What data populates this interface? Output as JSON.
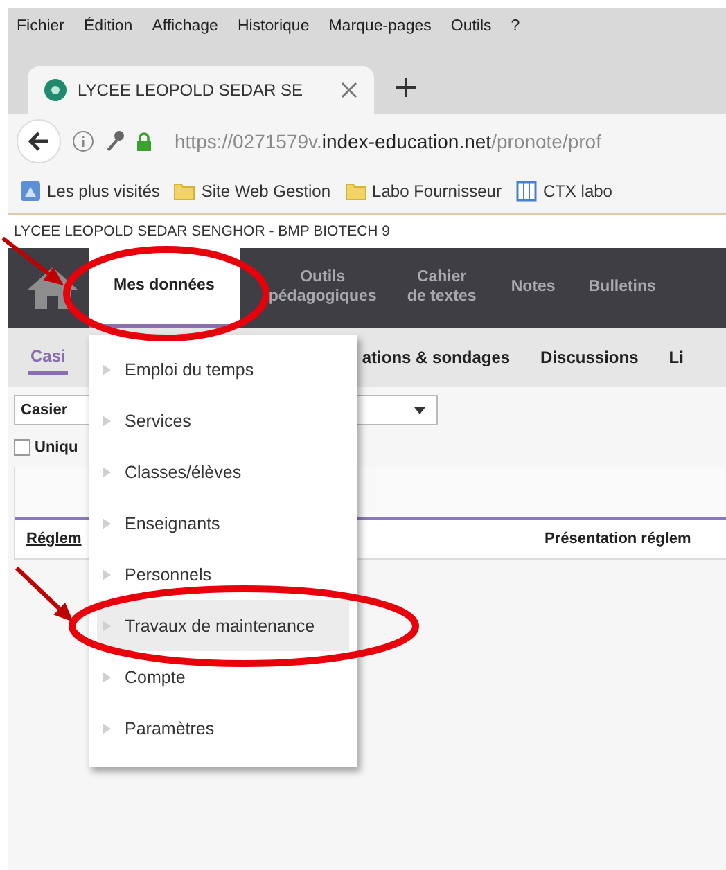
{
  "menu_bar": [
    "Fichier",
    "Édition",
    "Affichage",
    "Historique",
    "Marque-pages",
    "Outils",
    "?"
  ],
  "browser_tab": {
    "title": "LYCEE LEOPOLD SEDAR SE",
    "selected": true
  },
  "address_bar": {
    "url_parts": [
      {
        "text": "https://0271579v.",
        "emphasis": false
      },
      {
        "text": "index-education.net",
        "emphasis": true
      },
      {
        "text": "/pronote/prof",
        "emphasis": false
      }
    ]
  },
  "bookmarks": [
    {
      "label": "Les plus visités",
      "kind": "history"
    },
    {
      "label": "Site Web Gestion",
      "kind": "folder"
    },
    {
      "label": "Labo Fournisseur",
      "kind": "folder"
    },
    {
      "label": "CTX labo",
      "kind": "page"
    }
  ],
  "page_title": "LYCEE LEOPOLD SEDAR SENGHOR - BMP BIOTECH 9",
  "nav": [
    {
      "label": "Mes données",
      "selected": true
    },
    {
      "label": "Outils pédagogiques",
      "selected": false
    },
    {
      "label": "Cahier de textes",
      "selected": false
    },
    {
      "label": "Notes",
      "selected": false
    },
    {
      "label": "Bulletins",
      "selected": false
    }
  ],
  "subtabs": [
    {
      "label": "Casi",
      "selected": true
    },
    {
      "label": "ations & sondages",
      "selected": false
    },
    {
      "label": "Discussions",
      "selected": false
    },
    {
      "label": "Li",
      "selected": false
    }
  ],
  "filter": {
    "value": "Casier"
  },
  "checkbox": {
    "label": "Uniqu",
    "checked": false
  },
  "table": {
    "rows": [
      {
        "link": "Réglem",
        "cell": "Présentation réglem"
      }
    ]
  },
  "dropdown": [
    {
      "label": "Emploi du temps",
      "selected": false
    },
    {
      "label": "Services",
      "selected": false
    },
    {
      "label": "Classes/élèves",
      "selected": false
    },
    {
      "label": "Enseignants",
      "selected": false
    },
    {
      "label": "Personnels",
      "selected": false
    },
    {
      "label": "Travaux de maintenance",
      "selected": true
    },
    {
      "label": "Compte",
      "selected": false
    },
    {
      "label": "Paramètres",
      "selected": false
    }
  ],
  "annotations": [
    {
      "kind": "arrow"
    },
    {
      "kind": "ellipse"
    },
    {
      "kind": "arrow"
    },
    {
      "kind": "ellipse"
    }
  ]
}
